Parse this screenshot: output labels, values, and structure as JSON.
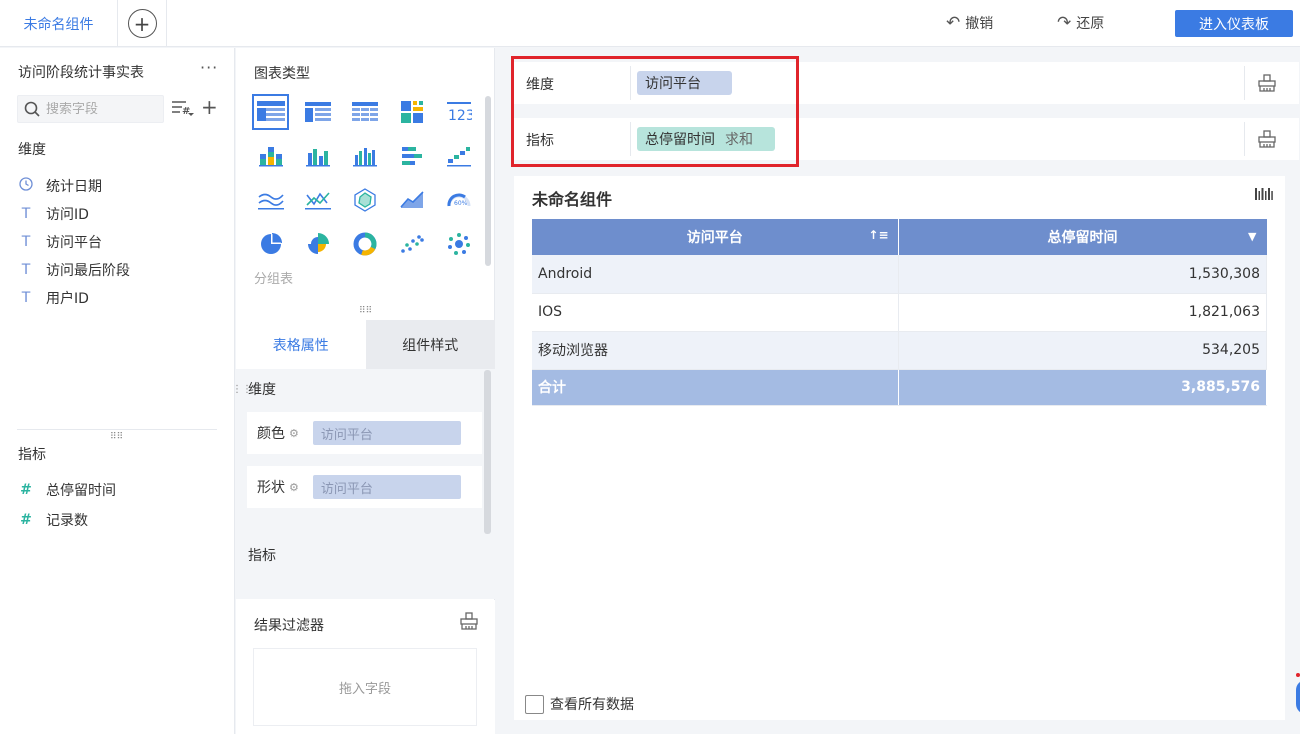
{
  "topbar": {
    "active_tab": "未命名组件",
    "add_tab_glyph": "+",
    "undo_label": "撤销",
    "redo_label": "还原",
    "enter_dashboard_label": "进入仪表板",
    "undo_icon": "undo-icon",
    "redo_icon": "redo-icon"
  },
  "left": {
    "dataset_title": "访问阶段统计事实表",
    "more_glyph": "···",
    "search_placeholder": "搜索字段",
    "dimension_section": "维度",
    "dimensions": [
      {
        "label": "统计日期",
        "icon": "clock-icon"
      },
      {
        "label": "访问ID",
        "icon": "text-type-icon"
      },
      {
        "label": "访问平台",
        "icon": "text-type-icon"
      },
      {
        "label": "访问最后阶段",
        "icon": "text-type-icon"
      },
      {
        "label": "用户ID",
        "icon": "text-type-icon"
      }
    ],
    "measure_section": "指标",
    "measures": [
      {
        "label": "总停留时间",
        "icon": "number-type-icon"
      },
      {
        "label": "记录数",
        "icon": "number-type-icon"
      }
    ]
  },
  "mid": {
    "chart_type_title": "图表类型",
    "group_table_label": "分组表",
    "tabs": [
      "表格属性",
      "组件样式"
    ],
    "prop_dimension_section": "维度",
    "color_label": "颜色",
    "color_value": "访问平台",
    "shape_label": "形状",
    "shape_value": "访问平台",
    "prop_measure_section": "指标",
    "result_filter_title": "结果过滤器",
    "drop_field_label": "拖入字段"
  },
  "shelves": {
    "dimension_label": "维度",
    "dimension_chip": "访问平台",
    "measure_label": "指标",
    "measure_chip": "总停留时间",
    "measure_agg": "求和"
  },
  "widget": {
    "title": "未命名组件",
    "columns": [
      "访问平台",
      "总停留时间"
    ],
    "rows": [
      {
        "platform": "Android",
        "value": "1,530,308"
      },
      {
        "platform": "IOS",
        "value": "1,821,063"
      },
      {
        "platform": "移动浏览器",
        "value": "534,205"
      }
    ],
    "total_label": "合计",
    "total_value": "3,885,576",
    "view_all_label": "查看所有数据"
  },
  "colors": {
    "accent": "#3b7be3",
    "header_bg": "#6e8ecd",
    "total_bg": "#a4bbe3",
    "dim_chip": "#c8d4ec",
    "measure_chip": "#b7e4dc",
    "highlight": "#e0242b"
  }
}
